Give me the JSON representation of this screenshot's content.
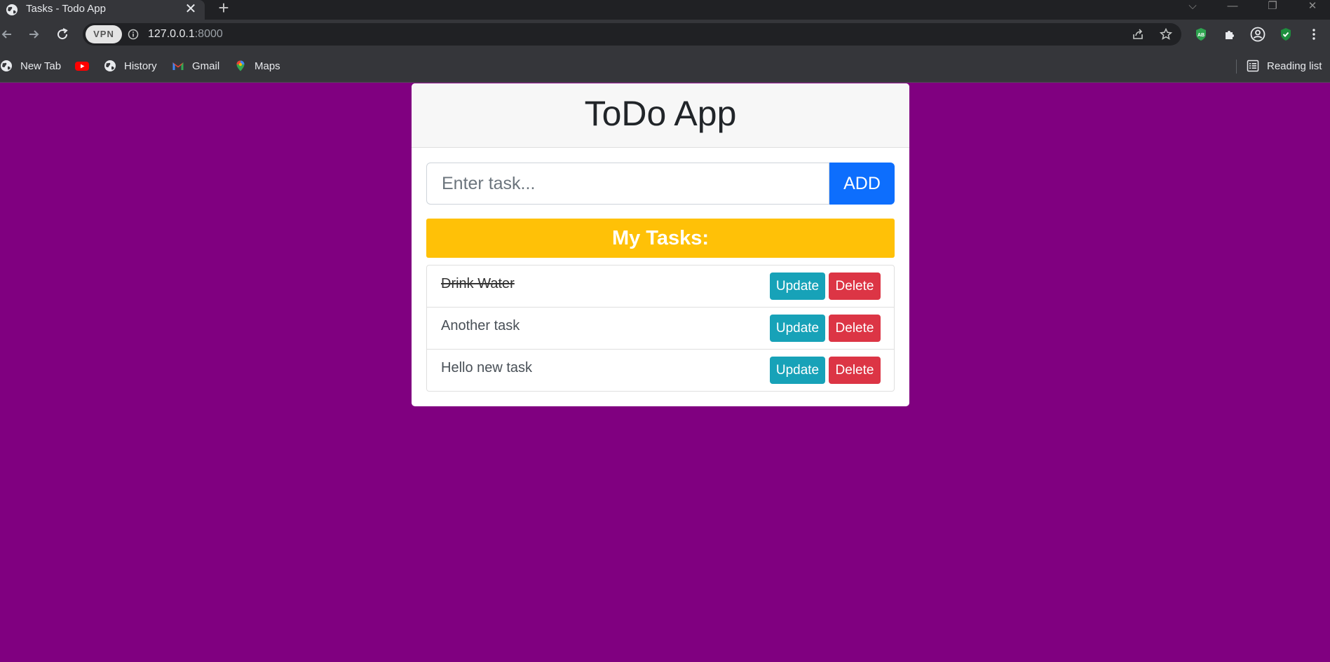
{
  "browser": {
    "tab": {
      "title": "Tasks - Todo App",
      "favicon": "globe-icon",
      "close_glyph": "✕"
    },
    "new_tab_glyph": "+",
    "window_controls": {
      "tablist": "⌵",
      "minimize": "—",
      "restore": "❐",
      "close": "✕"
    },
    "vpn_label": "VPN",
    "url": {
      "host": "127.0.0.1",
      "port": ":8000"
    },
    "extensions": [
      "adblock-icon",
      "puzzle-icon",
      "profile-icon",
      "shield-check-icon",
      "more-icon"
    ],
    "bookmarks": [
      {
        "label": "New Tab",
        "icon": "globe-icon"
      },
      {
        "label": "",
        "icon": "youtube-icon"
      },
      {
        "label": "History",
        "icon": "globe-icon"
      },
      {
        "label": "Gmail",
        "icon": "gmail-icon"
      },
      {
        "label": "Maps",
        "icon": "maps-icon"
      }
    ],
    "reading_list": "Reading list"
  },
  "colors": {
    "page_bg": "#800080",
    "add_button": "#0d6efd",
    "tasks_header": "#ffc107",
    "update_button": "#17a2b8",
    "delete_button": "#dc3545"
  },
  "app": {
    "title": "ToDo App",
    "input_placeholder": "Enter task...",
    "add_label": "ADD",
    "tasks_heading": "My Tasks:",
    "tasks": [
      {
        "text": "Drink Water",
        "completed": true,
        "update_label": "Update",
        "delete_label": "Delete"
      },
      {
        "text": "Another task",
        "completed": false,
        "update_label": "Update",
        "delete_label": "Delete"
      },
      {
        "text": "Hello new task",
        "completed": false,
        "update_label": "Update",
        "delete_label": "Delete"
      }
    ]
  }
}
